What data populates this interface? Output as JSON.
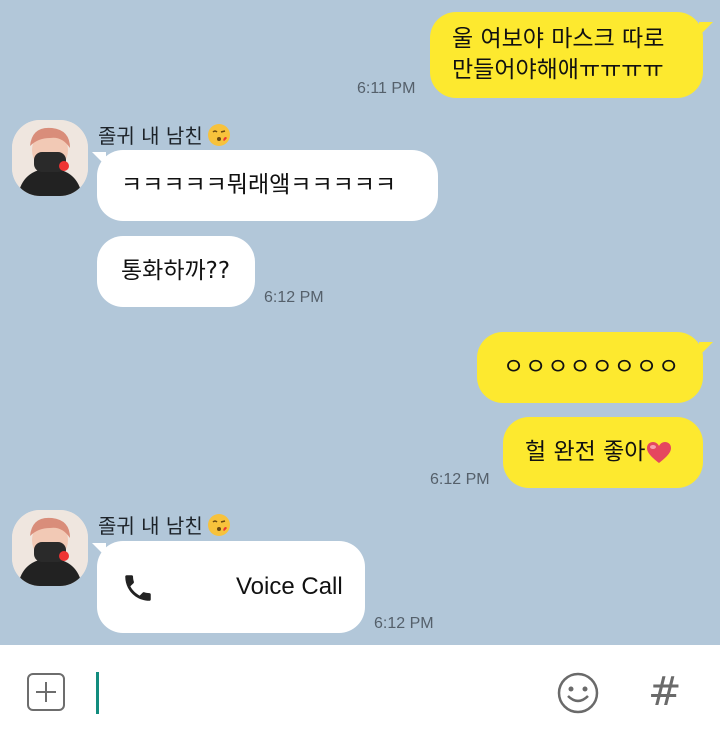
{
  "messages": [
    {
      "side": "me",
      "text_line1": "울 여보야 마스크 따로",
      "text_line2": "만들어야해애ㅠㅠㅠㅠ",
      "time": "6:11 PM"
    },
    {
      "side": "them",
      "sender": "졸귀 내 남친",
      "text": "ㅋㅋㅋㅋㅋ뭐래앸ㅋㅋㅋㅋㅋ"
    },
    {
      "side": "them",
      "text": "통화하까??",
      "time": "6:12 PM"
    },
    {
      "side": "me",
      "text": "ㅇㅇㅇㅇㅇㅇㅇㅇ"
    },
    {
      "side": "me",
      "text": "헐 완전 좋아",
      "time": "6:12 PM"
    },
    {
      "side": "them",
      "sender": "졸귀 내 남친",
      "call_label": "Voice Call",
      "time": "6:12 PM"
    }
  ],
  "icons": {
    "add": "plus-square-icon",
    "emoji": "smiley-icon",
    "hashtag": "hashtag-icon",
    "call": "phone-icon",
    "heart": "heart-icon",
    "kiss": "kiss-emoji-icon"
  },
  "input": {
    "placeholder": "",
    "hash_symbol": "#"
  },
  "colors": {
    "background": "#b2c7d9",
    "my_bubble": "#fde92f",
    "their_bubble": "#ffffff",
    "cursor": "#128c7e"
  }
}
